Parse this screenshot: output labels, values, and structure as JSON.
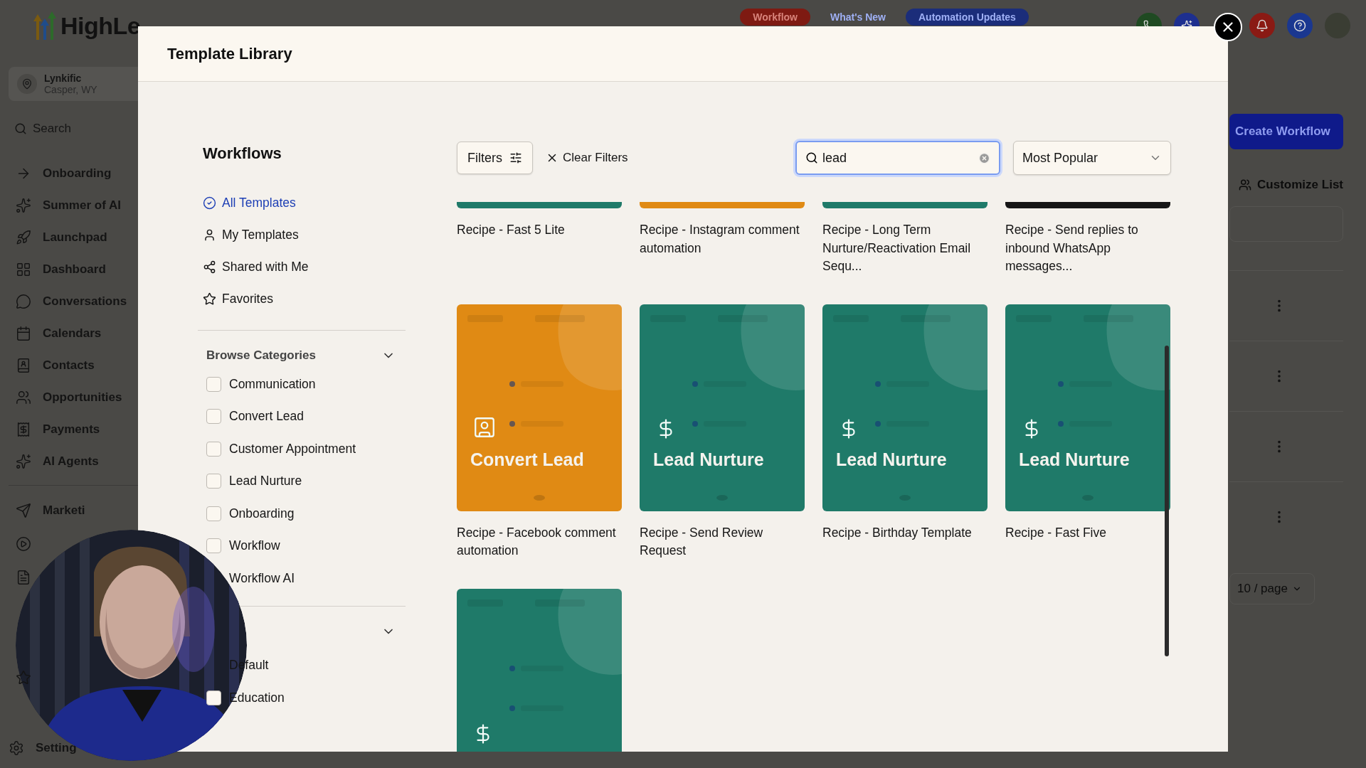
{
  "topbar": {
    "logo": "HighLe",
    "pills": [
      {
        "label": "Workflow",
        "kind": "alert"
      },
      {
        "label": "What's New",
        "kind": "link"
      },
      {
        "label": "Automation Updates",
        "kind": "tag"
      }
    ]
  },
  "sidebar": {
    "account": {
      "name": "Lynkific",
      "location": "Casper, WY"
    },
    "search": {
      "placeholder": "Search"
    },
    "items": [
      {
        "label": "Onboarding"
      },
      {
        "label": "Summer of AI"
      },
      {
        "label": "Launchpad"
      },
      {
        "label": "Dashboard"
      },
      {
        "label": "Conversations"
      },
      {
        "label": "Calendars"
      },
      {
        "label": "Contacts"
      },
      {
        "label": "Opportunities"
      },
      {
        "label": "Payments"
      },
      {
        "label": "AI Agents"
      }
    ],
    "lower_items": [
      {
        "label": "Marketi"
      }
    ],
    "settings": {
      "label": "Setting"
    }
  },
  "background": {
    "create_button": "Create Workflow",
    "customize": "Customize List",
    "page_size": "10 / page"
  },
  "modal": {
    "title": "Template Library",
    "panel": {
      "heading": "Workflows",
      "nav": [
        {
          "label": "All Templates",
          "selected": true
        },
        {
          "label": "My Templates",
          "selected": false
        },
        {
          "label": "Shared with Me",
          "selected": false
        },
        {
          "label": "Favorites",
          "selected": false
        }
      ],
      "sections": [
        {
          "title": "Browse Categories",
          "expanded": true,
          "options": [
            {
              "label": "Communication",
              "checked": false
            },
            {
              "label": "Convert Lead",
              "checked": false
            },
            {
              "label": "Customer Appointment",
              "checked": false
            },
            {
              "label": "Lead Nurture",
              "checked": false
            },
            {
              "label": "Onboarding",
              "checked": false
            },
            {
              "label": "Workflow",
              "checked": false
            },
            {
              "label": "Workflow AI"
            }
          ]
        },
        {
          "expanded": true,
          "options": [
            {
              "label": "Default"
            },
            {
              "label": "Education",
              "checked": false
            }
          ]
        }
      ]
    },
    "toolbar": {
      "filters": "Filters",
      "clear": "Clear Filters",
      "search": {
        "value": "lead"
      },
      "sort": "Most Popular"
    },
    "cards": [
      {
        "title": "Recipe - Fast 5 Lite",
        "color": "#1f7a69"
      },
      {
        "title": "Recipe - Instagram comment automation",
        "color": "#e08a14"
      },
      {
        "title": "Recipe - Long Term Nurture/Reactivation Email Sequ...",
        "color": "#1f7a69"
      },
      {
        "title": "Recipe - Send replies to inbound WhatsApp messages...",
        "color": "#161616"
      },
      {
        "title": "Recipe - Facebook comment automation",
        "color": "#e08a14",
        "kind": "convert-lead",
        "category": "Convert Lead"
      },
      {
        "title": "Recipe - Send Review Request",
        "color": "#1f7a69",
        "kind": "lead-nurture",
        "category": "Lead Nurture"
      },
      {
        "title": "Recipe - Birthday Template",
        "color": "#1f7a69",
        "kind": "lead-nurture",
        "category": "Lead Nurture"
      },
      {
        "title": "Recipe - Fast Five",
        "color": "#1f7a69",
        "kind": "lead-nurture",
        "category": "Lead Nurture"
      },
      {
        "color": "#1f7a69",
        "kind": "lead-nurture"
      }
    ]
  }
}
